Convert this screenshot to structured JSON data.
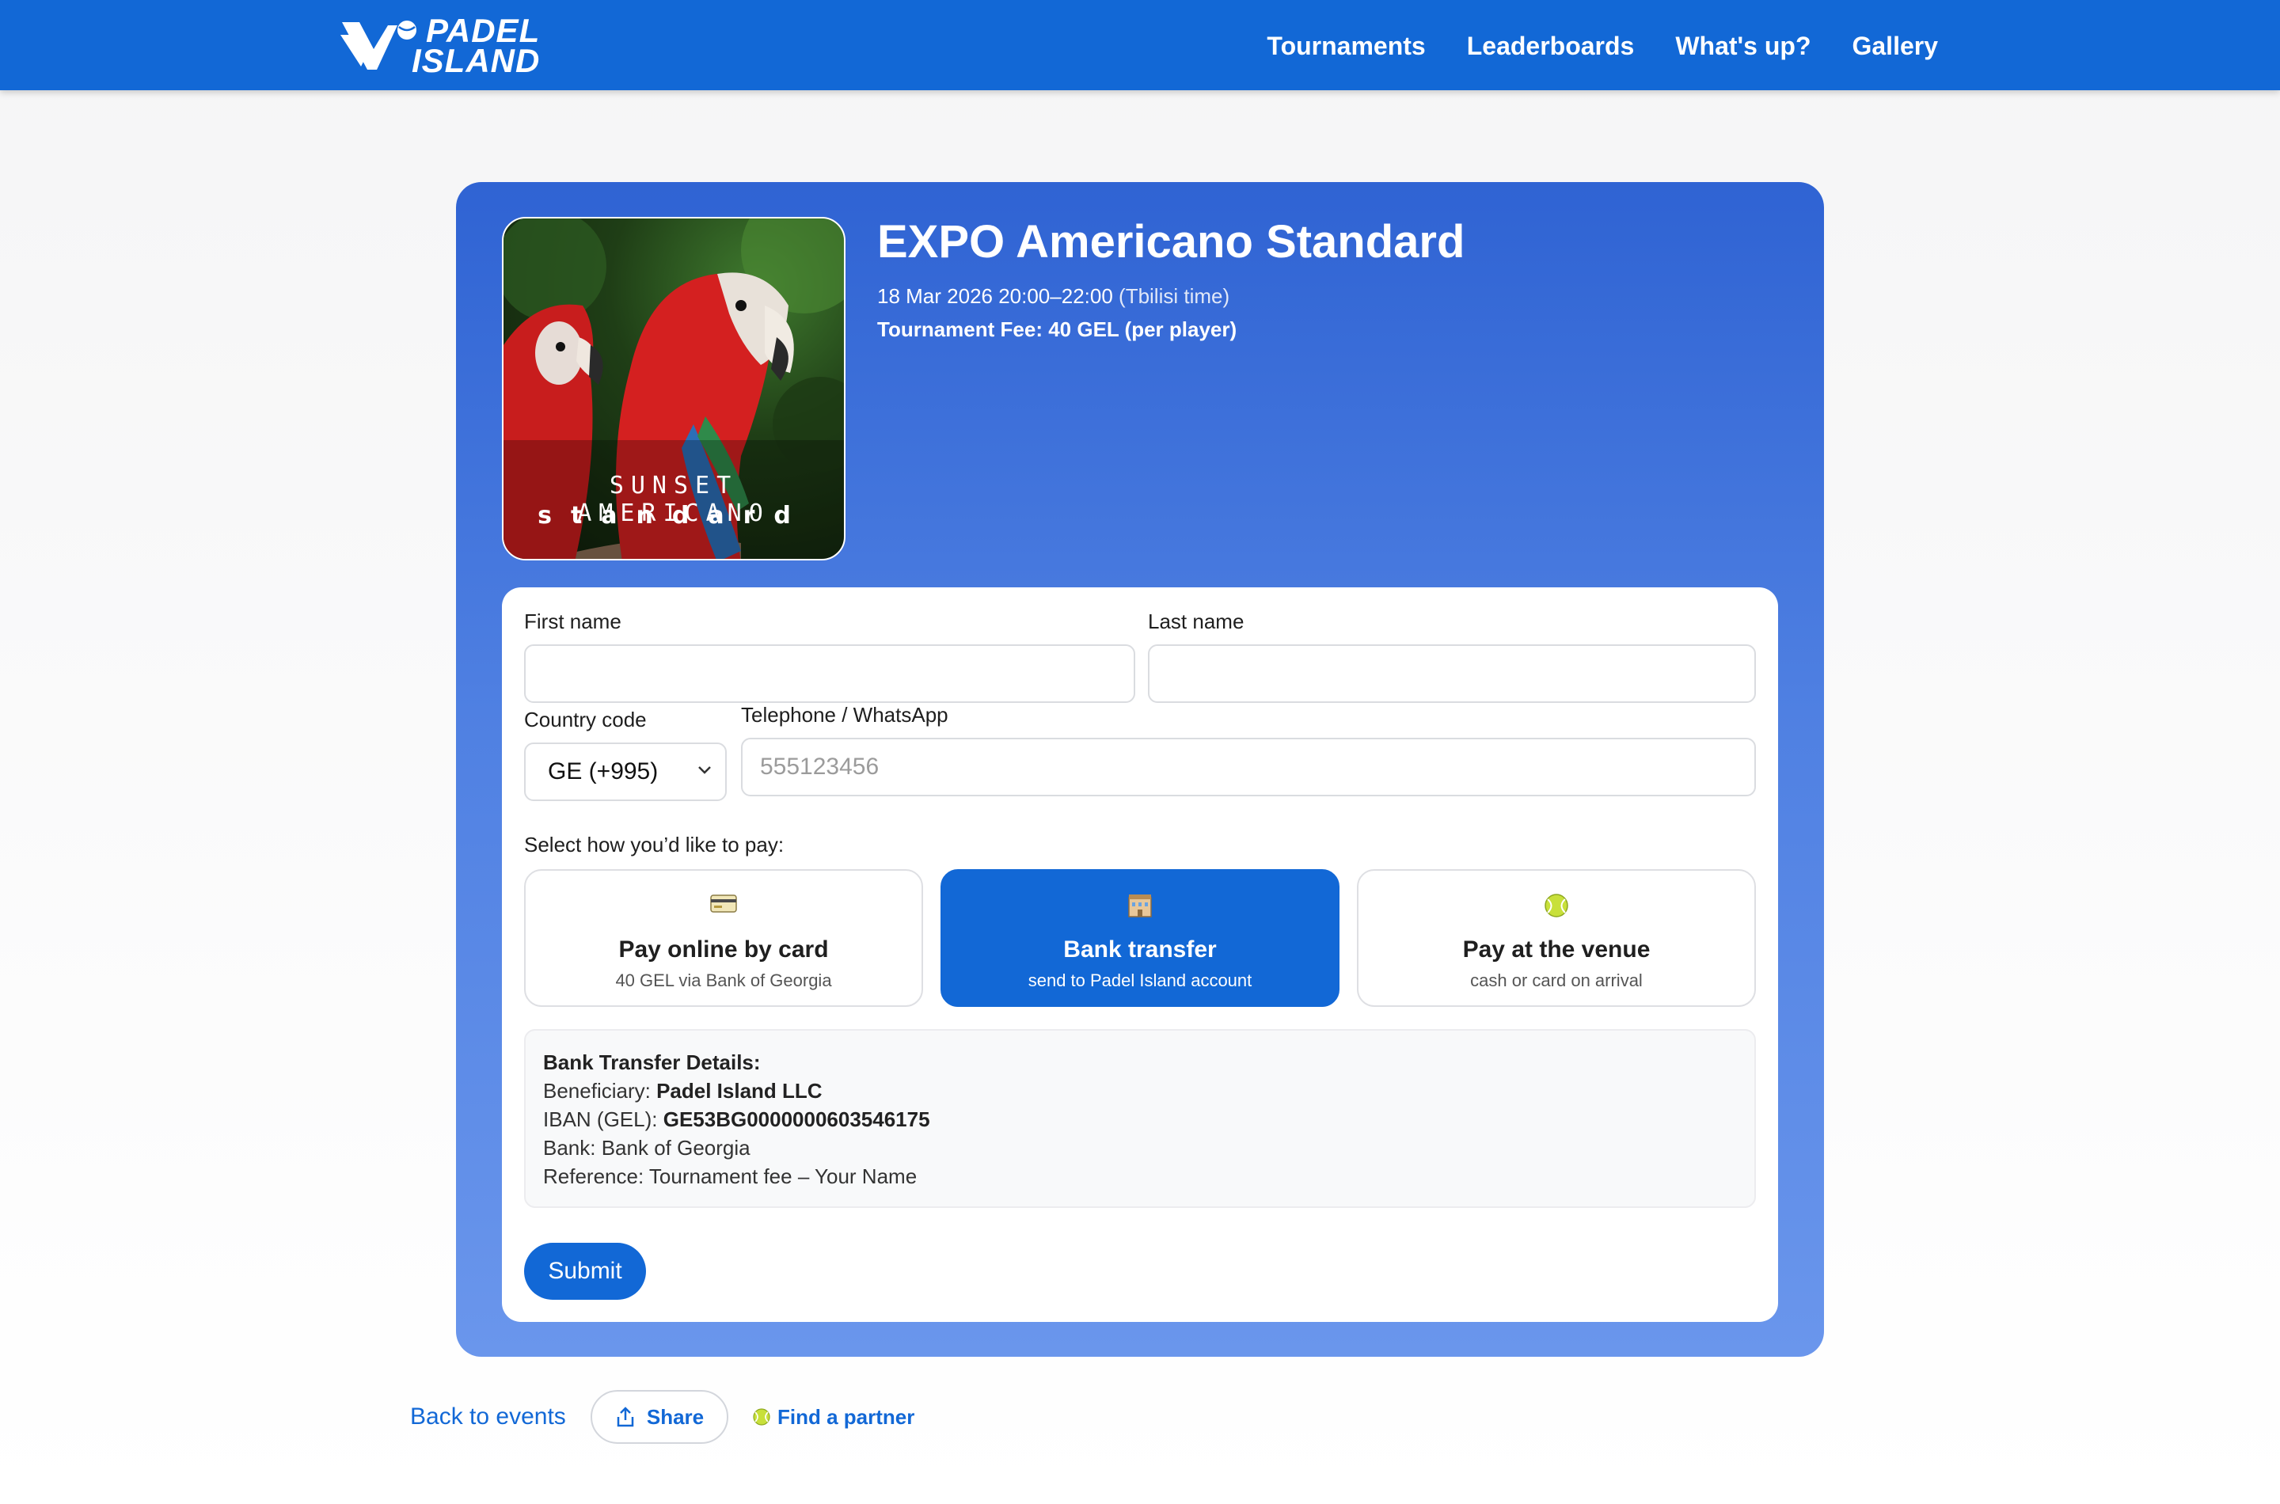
{
  "header": {
    "logo_line1": "PADEL",
    "logo_line2": "ISLAND",
    "nav": [
      "Tournaments",
      "Leaderboards",
      "What's up?",
      "Gallery"
    ]
  },
  "event": {
    "title": "EXPO Americano Standard",
    "date": "18 Mar 2026 20:00–22:00",
    "timezone": "(Tbilisi time)",
    "fee": "Tournament Fee: 40 GEL (per player)",
    "poster_line1": "SUNSET AMERICANO",
    "poster_line2": "standard"
  },
  "form": {
    "first_name_label": "First name",
    "last_name_label": "Last name",
    "first_name_value": "",
    "last_name_value": "",
    "country_code_label": "Country code",
    "country_code_value": "GE (+995)",
    "phone_label": "Telephone / WhatsApp",
    "phone_placeholder": "555123456",
    "pay_prompt": "Select how you’d like to pay:",
    "pay_options": [
      {
        "icon": "credit-card-icon",
        "title": "Pay online by card",
        "subtitle": "40 GEL via Bank of Georgia",
        "selected": false
      },
      {
        "icon": "bank-icon",
        "title": "Bank transfer",
        "subtitle": "send to Padel Island account",
        "selected": true
      },
      {
        "icon": "tennis-ball-icon",
        "title": "Pay at the venue",
        "subtitle": "cash or card on arrival",
        "selected": false
      }
    ],
    "bank_details": {
      "heading": "Bank Transfer Details:",
      "beneficiary_label": "Beneficiary:",
      "beneficiary_value": "Padel Island LLC",
      "iban_label": "IBAN (GEL):",
      "iban_value": "GE53BG0000000603546175",
      "bank_line": "Bank: Bank of Georgia",
      "reference_line": "Reference: Tournament fee – Your Name"
    },
    "submit_label": "Submit"
  },
  "footer": {
    "back_label": "Back to events",
    "share_label": "Share",
    "partner_label": "Find a partner"
  },
  "colors": {
    "brand_blue": "#1268d6",
    "card_gradient_top": "#2f63d3",
    "card_gradient_bottom": "#6a96ec",
    "tennis_ball": "#c8e03a"
  }
}
